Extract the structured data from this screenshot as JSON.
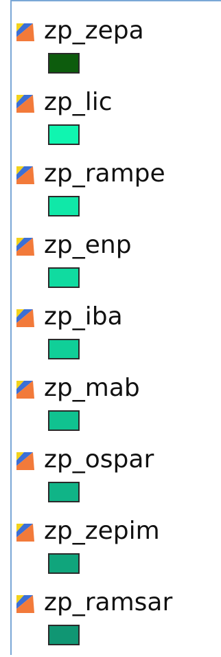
{
  "layers": [
    {
      "name": "zp_zepa",
      "icon": "polygon-layer-icon",
      "symbol_color": "#0d5c0d"
    },
    {
      "name": "zp_lic",
      "icon": "polygon-layer-icon",
      "symbol_color": "#10f5b0"
    },
    {
      "name": "zp_rampe",
      "icon": "polygon-layer-icon",
      "symbol_color": "#10e8a8"
    },
    {
      "name": "zp_enp",
      "icon": "polygon-layer-icon",
      "symbol_color": "#10dba0"
    },
    {
      "name": "zp_iba",
      "icon": "polygon-layer-icon",
      "symbol_color": "#10cf98"
    },
    {
      "name": "zp_mab",
      "icon": "polygon-layer-icon",
      "symbol_color": "#10c290"
    },
    {
      "name": "zp_ospar",
      "icon": "polygon-layer-icon",
      "symbol_color": "#10b487"
    },
    {
      "name": "zp_zepim",
      "icon": "polygon-layer-icon",
      "symbol_color": "#10a57c"
    },
    {
      "name": "zp_ramsar",
      "icon": "polygon-layer-icon",
      "symbol_color": "#109673"
    }
  ]
}
